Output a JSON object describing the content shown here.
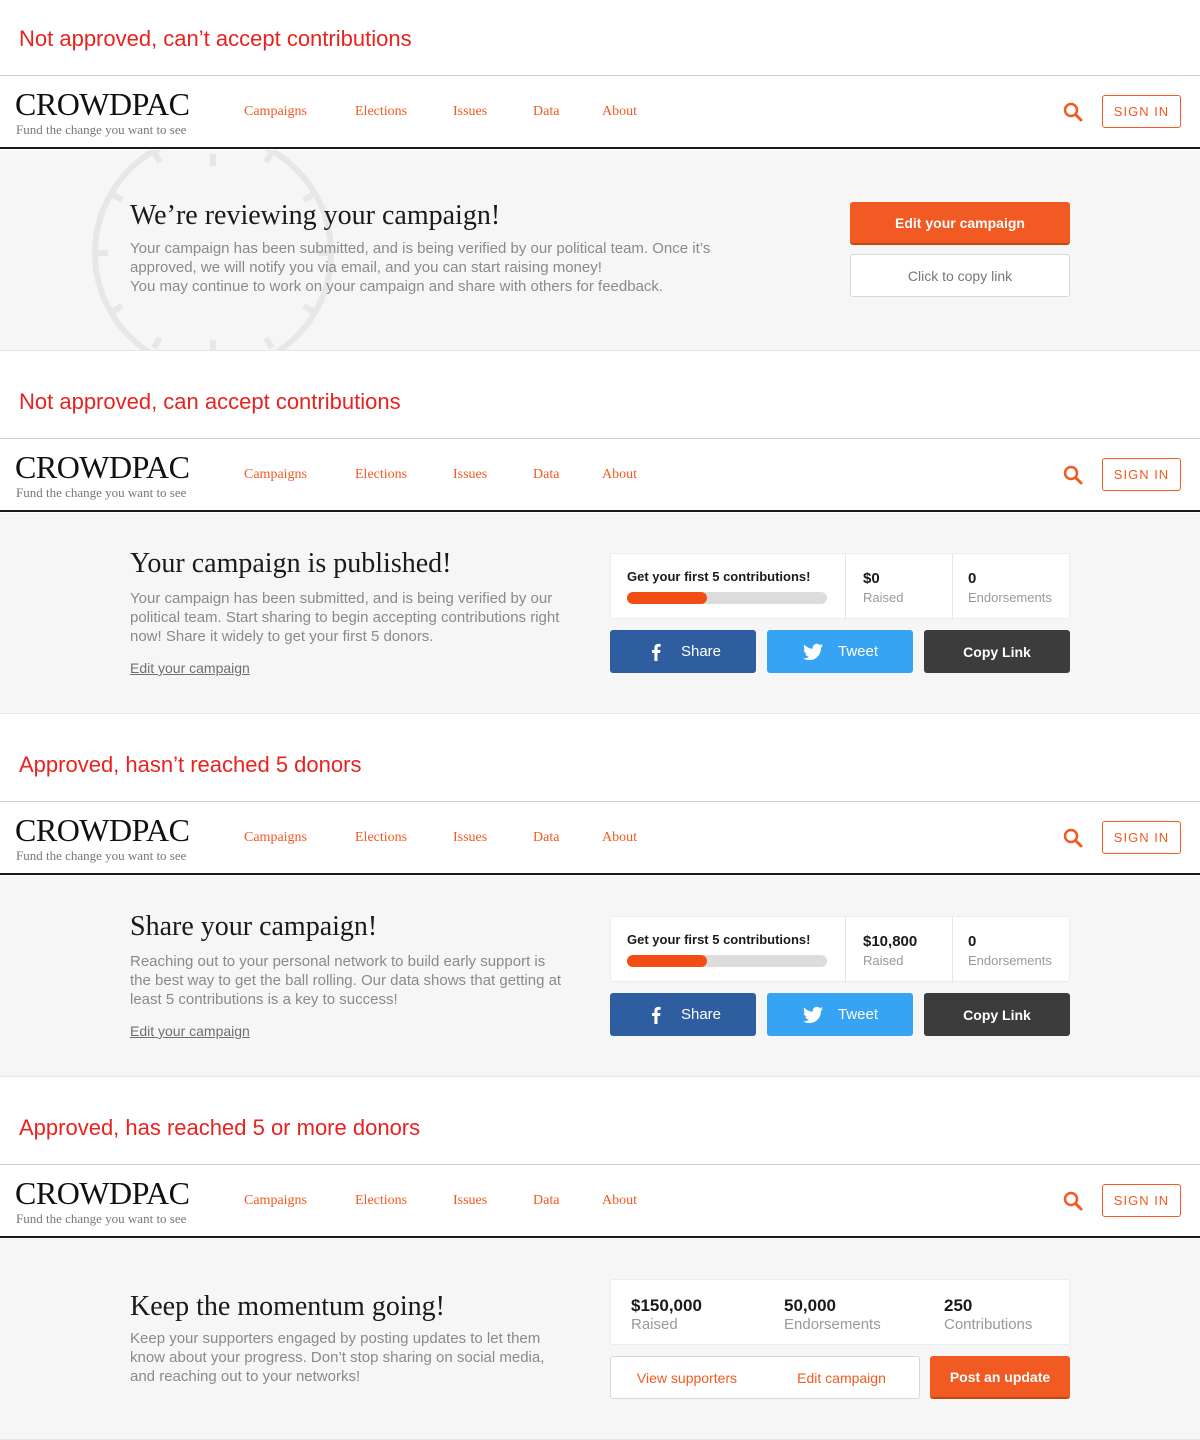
{
  "nav": {
    "logo": "CROWDPAC",
    "tagline": "Fund the change you want to see",
    "links": [
      "Campaigns",
      "Elections",
      "Issues",
      "Data",
      "About"
    ],
    "sign_in": "SIGN IN"
  },
  "colors": {
    "accent": "#f15a22",
    "label_red": "#e8231f",
    "facebook": "#2e5e9f",
    "twitter": "#37a3f3",
    "copy_dark": "#3c3c3c",
    "progress": "#f24d12"
  },
  "icons": {
    "search": "search-icon",
    "facebook": "facebook-icon",
    "twitter": "twitter-icon",
    "clock": "clock-icon"
  },
  "states": [
    {
      "label": "Not approved, can’t accept contributions",
      "title": "We’re reviewing your campaign!",
      "text": "Your campaign has been submitted, and is being verified by our political team. Once it’s\napproved, we will notify you via email, and you can start raising money!\nYou may continue to work on your campaign and share with others for feedback.",
      "primary_button": "Edit your campaign",
      "secondary_button": "Click to copy link"
    },
    {
      "label": "Not approved, can accept contributions",
      "title": "Your campaign is published!",
      "text": "Your campaign has been submitted, and is being verified by our\npolitical team. Start sharing to begin accepting contributions right\nnow! Share it widely to get your first 5 donors.",
      "edit_link": "Edit your campaign",
      "goal_label": "Get your first 5 contributions!",
      "progress": 0.4,
      "raised_value": "$0",
      "raised_label": "Raised",
      "endorsements_value": "0",
      "endorsements_label": "Endorsements",
      "share": "Share",
      "tweet": "Tweet",
      "copy_link": "Copy Link"
    },
    {
      "label": "Approved, hasn’t reached 5 donors",
      "title": "Share your campaign!",
      "text": "Reaching out to your personal network to build early support is\nthe best way to get the ball rolling. Our data shows that getting at\nleast 5 contributions is a key to success!",
      "edit_link": "Edit your campaign",
      "goal_label": "Get your first 5 contributions!",
      "progress": 0.4,
      "raised_value": "$10,800",
      "raised_label": "Raised",
      "endorsements_value": "0",
      "endorsements_label": "Endorsements",
      "share": "Share",
      "tweet": "Tweet",
      "copy_link": "Copy Link"
    },
    {
      "label": "Approved, has reached 5 or more donors",
      "title": "Keep the momentum going!",
      "text": "Keep your supporters engaged by posting updates to let them\nknow about your progress. Don’t stop sharing on social media,\nand reaching out to your networks!",
      "raised_value": "$150,000",
      "raised_label": "Raised",
      "endorsements_value": "50,000",
      "endorsements_label": "Endorsements",
      "contributions_value": "250",
      "contributions_label": "Contributions",
      "view_supporters": "View supporters",
      "edit_campaign": "Edit campaign",
      "post_update": "Post an update"
    }
  ]
}
